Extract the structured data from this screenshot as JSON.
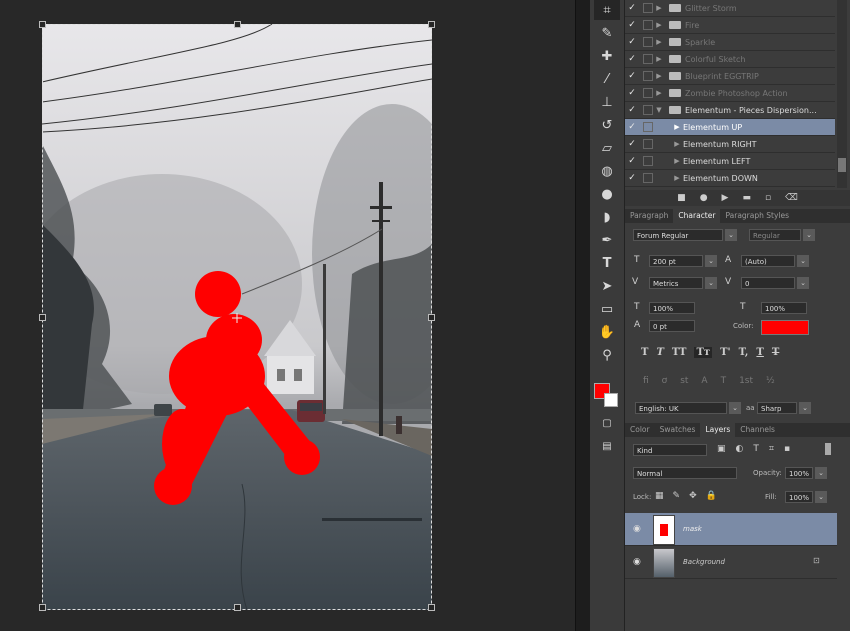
{
  "colors": {
    "accent_red": "#ff0000",
    "selected_row": "#7b8ba6",
    "panel_bg": "#3c3c3c"
  },
  "layers_top": {
    "dim_items": [
      "Glitter Storm",
      "Fire",
      "Sparkle",
      "Colorful Sketch",
      "Blueprint EGGTRIP",
      "Zombie Photoshop Action"
    ],
    "group_name": "Elementum - Pieces Dispersion...",
    "sub_items": [
      "Elementum UP",
      "Elementum RIGHT",
      "Elementum LEFT",
      "Elementum DOWN"
    ]
  },
  "char_tabs": [
    "Paragraph",
    "Character",
    "Paragraph Styles"
  ],
  "character": {
    "font_family": "Forum Regular",
    "font_style": "Regular",
    "size": "200 pt",
    "leading": "(Auto)",
    "kerning": "Metrics",
    "tracking": "0",
    "vscale": "100%",
    "hscale": "100%",
    "baseline": "0 pt",
    "color_label": "Color:",
    "language": "English: UK",
    "aa_label": "aa",
    "antialias": "Sharp"
  },
  "layer_tabs": [
    "Color",
    "Swatches",
    "Layers",
    "Channels"
  ],
  "layers_panel": {
    "kind": "Kind",
    "blend": "Normal",
    "opacity_label": "Opacity:",
    "opacity": "100%",
    "lock_label": "Lock:",
    "fill_label": "Fill:",
    "fill": "100%",
    "layers": [
      "mask",
      "Background"
    ]
  },
  "icons": [
    "crop-icon",
    "eyedropper-icon",
    "healing-icon",
    "brush-icon",
    "stamp-icon",
    "history-brush-icon",
    "eraser-icon",
    "bucket-icon",
    "blur-icon",
    "dodge-icon",
    "pen-icon",
    "type-icon",
    "path-select-icon",
    "shape-icon",
    "hand-icon",
    "zoom-icon"
  ]
}
